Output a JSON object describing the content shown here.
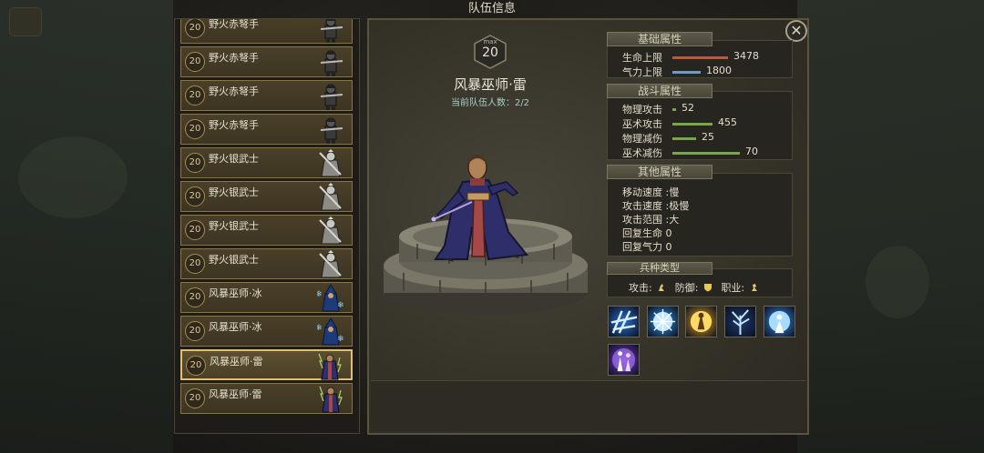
{
  "window_title": "队伍信息",
  "close_symbol": "✕",
  "roster": [
    {
      "level": "20",
      "name": "野火赤弩手",
      "type": "crossbow"
    },
    {
      "level": "20",
      "name": "野火赤弩手",
      "type": "crossbow"
    },
    {
      "level": "20",
      "name": "野火赤弩手",
      "type": "crossbow"
    },
    {
      "level": "20",
      "name": "野火赤弩手",
      "type": "crossbow"
    },
    {
      "level": "20",
      "name": "野火银武士",
      "type": "knight"
    },
    {
      "level": "20",
      "name": "野火银武士",
      "type": "knight"
    },
    {
      "level": "20",
      "name": "野火银武士",
      "type": "knight"
    },
    {
      "level": "20",
      "name": "野火银武士",
      "type": "knight"
    },
    {
      "level": "20",
      "name": "风暴巫师·冰",
      "type": "ice-mage"
    },
    {
      "level": "20",
      "name": "风暴巫师·冰",
      "type": "ice-mage"
    },
    {
      "level": "20",
      "name": "风暴巫师·雷",
      "type": "thunder-mage",
      "selected": true
    },
    {
      "level": "20",
      "name": "风暴巫师·雷",
      "type": "thunder-mage"
    }
  ],
  "unit": {
    "max_label": "max",
    "max_level": "20",
    "name": "风暴巫师·雷",
    "team_count": "当前队伍人数：2/2"
  },
  "base_stats": {
    "title": "基础属性",
    "rows": [
      {
        "label": "生命上限",
        "value": "3478",
        "bar_color": "#c0563a",
        "fraction": 0.55
      },
      {
        "label": "气力上限",
        "value": "1800",
        "bar_color": "#6a9ec4",
        "fraction": 0.28
      }
    ]
  },
  "combat_stats": {
    "title": "战斗属性",
    "rows": [
      {
        "label": "物理攻击",
        "value": "52",
        "bar_color": "#7aa64a",
        "fraction": 0.04
      },
      {
        "label": "巫术攻击",
        "value": "455",
        "bar_color": "#7aa64a",
        "fraction": 0.4
      },
      {
        "label": "物理减伤",
        "value": "25",
        "bar_color": "#7aa64a",
        "fraction": 0.24
      },
      {
        "label": "巫术减伤",
        "value": "70",
        "bar_color": "#7aa64a",
        "fraction": 0.67
      }
    ]
  },
  "other_stats": {
    "title": "其他属性",
    "rows": [
      {
        "text": "移动速度 :慢"
      },
      {
        "text": "攻击速度 :极慢"
      },
      {
        "text": "攻击范围 :大"
      },
      {
        "text": "回复生命   0"
      },
      {
        "text": "回复气力   0"
      }
    ]
  },
  "unit_type": {
    "title": "兵种类型",
    "attack_label": "攻击:",
    "defense_label": "防御:",
    "class_label": "职业:"
  },
  "skills": [
    {
      "icon": "chain-lightning-icon",
      "color": "#2a6fd0"
    },
    {
      "icon": "frost-burst-icon",
      "color": "#2d8fe0"
    },
    {
      "icon": "golden-aura-icon",
      "color": "#e0a020"
    },
    {
      "icon": "thunder-tree-icon",
      "color": "#1e3a70"
    },
    {
      "icon": "ice-figure-icon",
      "color": "#3a8ee6"
    },
    {
      "icon": "arcane-figure-icon",
      "color": "#7a3ad0"
    }
  ]
}
